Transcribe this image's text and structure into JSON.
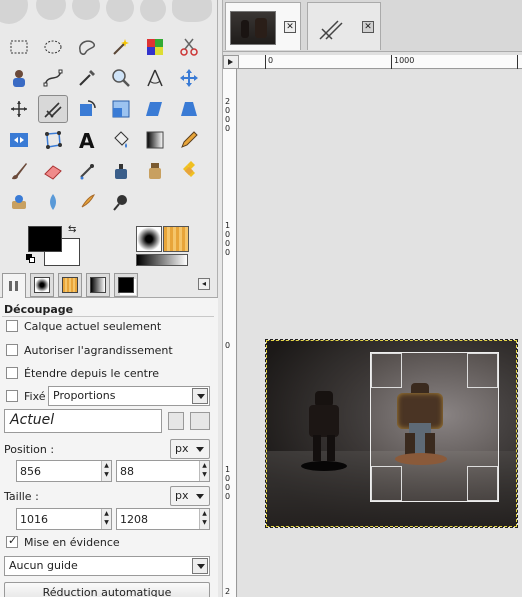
{
  "toolbox": {
    "tools": [
      {
        "name": "rect-select-icon"
      },
      {
        "name": "ellipse-select-icon"
      },
      {
        "name": "free-select-icon"
      },
      {
        "name": "fuzzy-select-icon"
      },
      {
        "name": "select-by-color-icon"
      },
      {
        "name": "scissors-select-icon"
      },
      {
        "name": "foreground-select-icon"
      },
      {
        "name": "paths-icon"
      },
      {
        "name": "color-picker-icon"
      },
      {
        "name": "zoom-icon"
      },
      {
        "name": "measure-icon"
      },
      {
        "name": "move-icon"
      },
      {
        "name": "align-icon"
      },
      {
        "name": "crop-icon"
      },
      {
        "name": "rotate-icon"
      },
      {
        "name": "scale-icon"
      },
      {
        "name": "shear-icon"
      },
      {
        "name": "perspective-icon"
      },
      {
        "name": "flip-icon"
      },
      {
        "name": "cage-transform-icon"
      },
      {
        "name": "text-icon"
      },
      {
        "name": "bucket-fill-icon"
      },
      {
        "name": "blend-icon"
      },
      {
        "name": "pencil-icon"
      },
      {
        "name": "paintbrush-icon"
      },
      {
        "name": "eraser-icon"
      },
      {
        "name": "airbrush-icon"
      },
      {
        "name": "ink-icon"
      },
      {
        "name": "clone-icon"
      },
      {
        "name": "heal-icon"
      },
      {
        "name": "perspective-clone-icon"
      },
      {
        "name": "blur-icon"
      },
      {
        "name": "smudge-icon"
      },
      {
        "name": "dodge-burn-icon"
      }
    ],
    "active_tool": "crop-icon",
    "colors": {
      "foreground": "#000000",
      "background": "#ffffff"
    }
  },
  "options": {
    "title": "Découpage",
    "current_layer_only": {
      "label": "Calque actuel seulement",
      "checked": false
    },
    "allow_growing": {
      "label": "Autoriser l'agrandissement",
      "checked": false
    },
    "expand_from_center": {
      "label": "Étendre depuis le centre",
      "checked": false
    },
    "fixed": {
      "label": "Fixé :",
      "checked": false,
      "value": "Proportions"
    },
    "aspect_value": "Actuel",
    "position": {
      "label": "Position :",
      "x": "856",
      "y": "88",
      "unit": "px"
    },
    "size": {
      "label": "Taille :",
      "w": "1016",
      "h": "1208",
      "unit": "px"
    },
    "highlight": {
      "label": "Mise en évidence",
      "checked": true
    },
    "guides": "Aucun guide",
    "auto_shrink": "Réduction automatique"
  },
  "image_window": {
    "ruler_h_ticks": [
      "0",
      "1000"
    ],
    "ruler_v_ticks": [
      {
        "text": "2\n0\n0\n0"
      },
      {
        "text": "1\n0\n0\n0"
      },
      {
        "text": "0"
      },
      {
        "text": "1\n0\n0\n0"
      },
      {
        "text": "2"
      }
    ]
  }
}
